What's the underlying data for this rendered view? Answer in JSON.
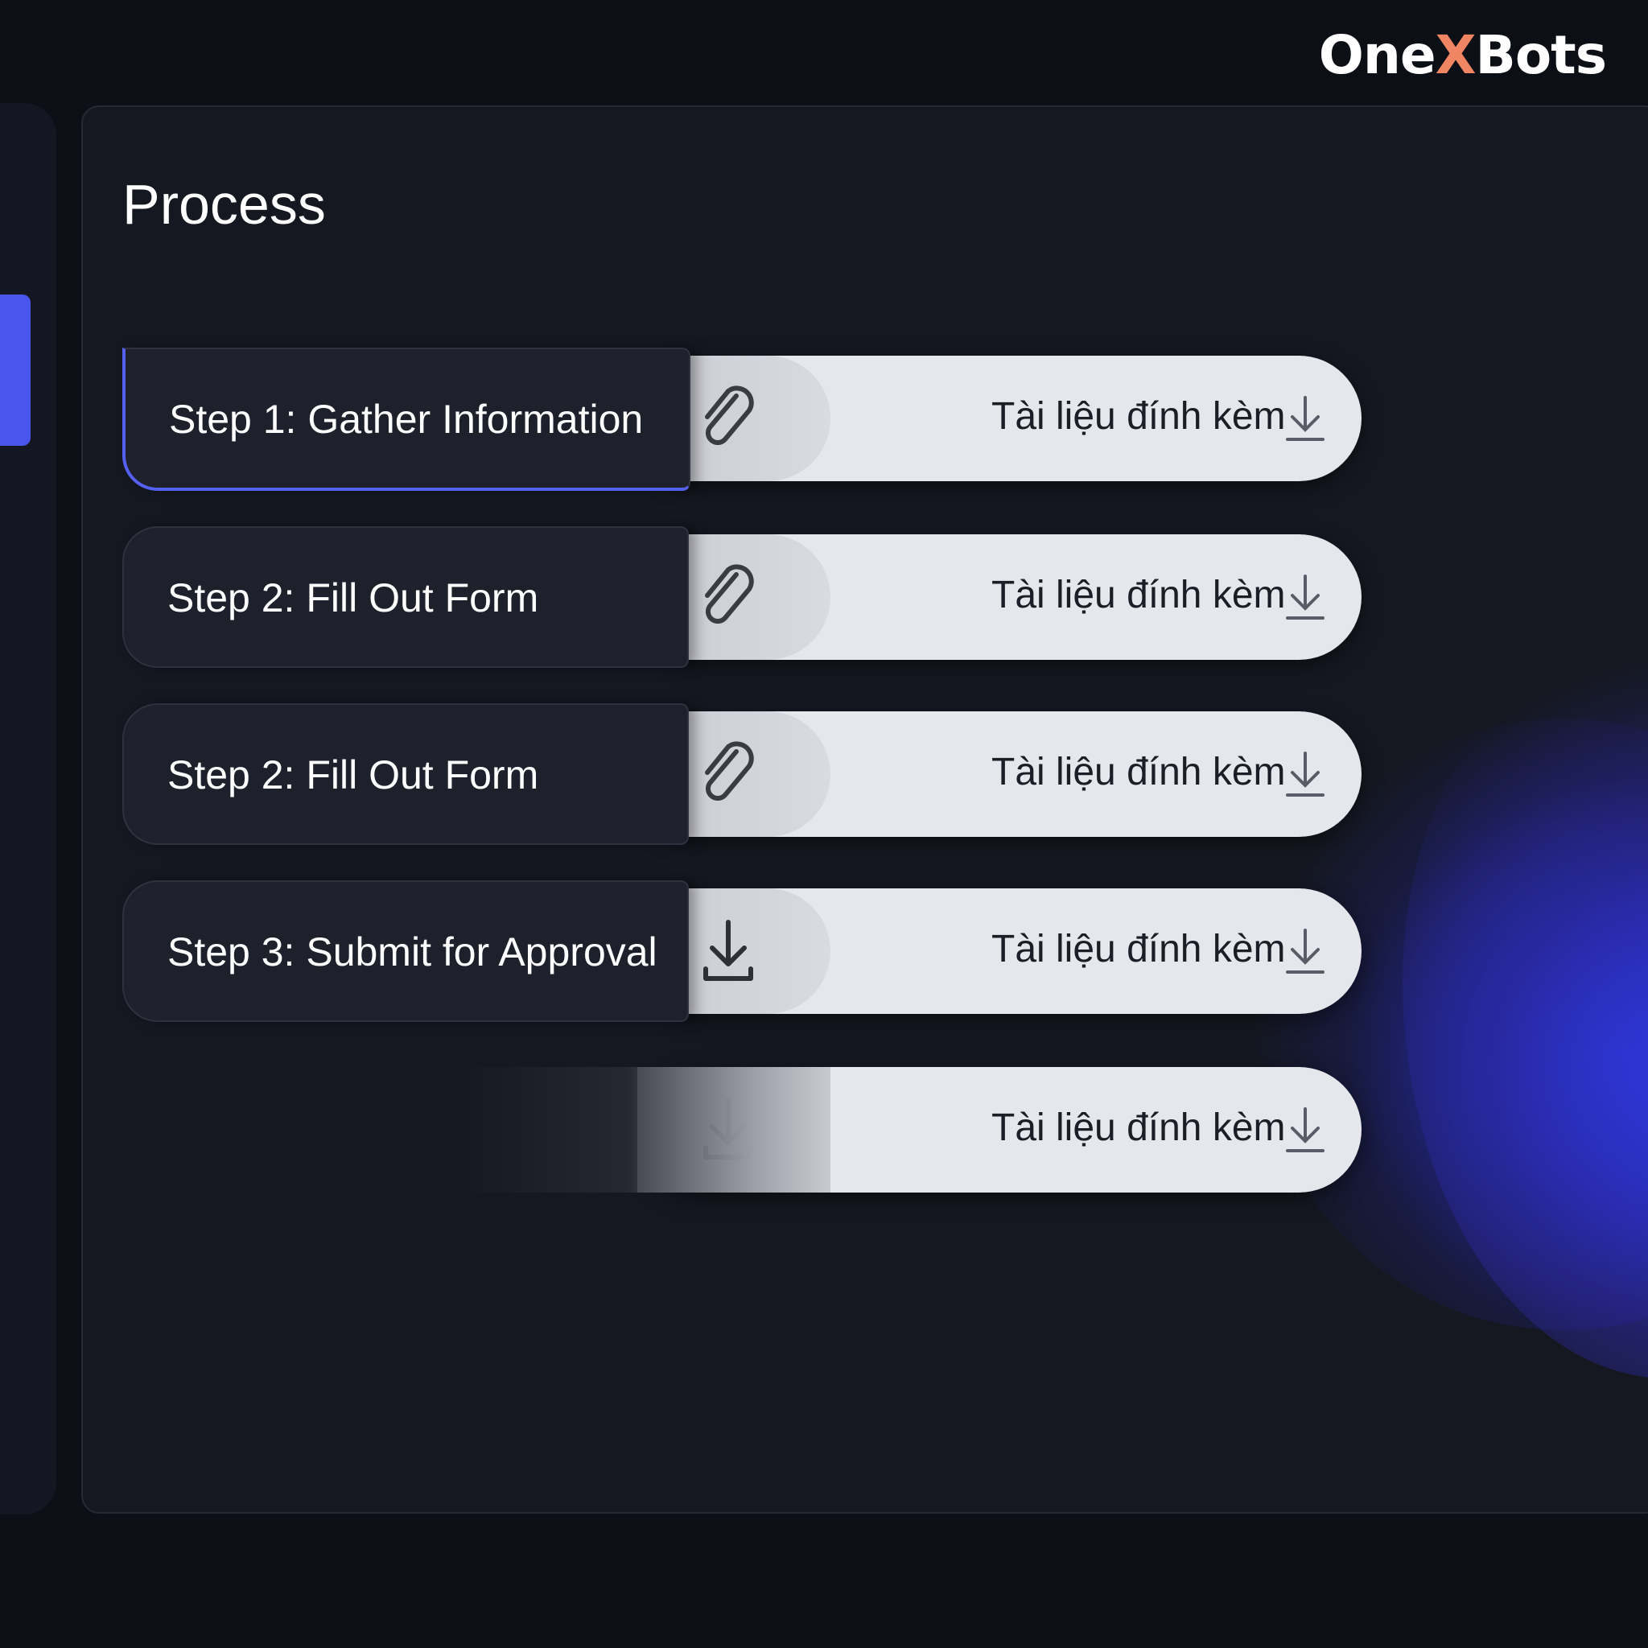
{
  "brand": {
    "name_pre": "One",
    "name_x": "X",
    "name_post": "Bots",
    "accent_color": "#f08563"
  },
  "page": {
    "title": "Process"
  },
  "steps": [
    {
      "label": "Step 1: Gather Information",
      "attachment_icon": "paperclip-icon",
      "attachment_label": "Tài liệu đính kèm",
      "active": true
    },
    {
      "label": "Step 2: Fill Out Form",
      "attachment_icon": "paperclip-icon",
      "attachment_label": "Tài liệu đính kèm",
      "active": false
    },
    {
      "label": "Step 2: Fill Out Form",
      "attachment_icon": "paperclip-icon",
      "attachment_label": "Tài liệu đính kèm",
      "active": false
    },
    {
      "label": "Step 3: Submit for Approval",
      "attachment_icon": "download-tray-icon",
      "attachment_label": "Tài liệu đính kèm",
      "active": false
    },
    {
      "label": "",
      "attachment_icon": "download-tray-icon",
      "attachment_label": "Tài liệu đính kèm",
      "active": false
    }
  ],
  "colors": {
    "active_accent": "#5560f0",
    "sidebar_active": "#4a55ee",
    "glow": "#2c3ce6"
  }
}
